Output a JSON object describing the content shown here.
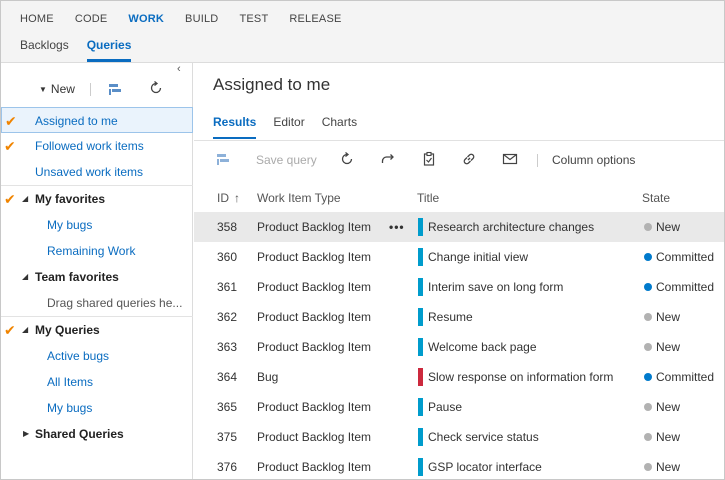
{
  "topnav": [
    "HOME",
    "CODE",
    "WORK",
    "BUILD",
    "TEST",
    "RELEASE"
  ],
  "topnav_active": "WORK",
  "subnav": [
    "Backlogs",
    "Queries"
  ],
  "subnav_active": "Queries",
  "left": {
    "collapse": "‹",
    "new_label": "New",
    "tree": [
      {
        "label": "Assigned to me",
        "type": "link",
        "check": true,
        "selected": true
      },
      {
        "label": "Followed work items",
        "type": "link",
        "check": true
      },
      {
        "label": "Unsaved work items",
        "type": "link"
      },
      {
        "label": "My favorites",
        "type": "head",
        "check": true,
        "expanded": true
      },
      {
        "label": "My bugs",
        "type": "link",
        "indent": true
      },
      {
        "label": "Remaining Work",
        "type": "link",
        "indent": true
      },
      {
        "label": "Team favorites",
        "type": "head",
        "expanded": true
      },
      {
        "label": "Drag shared queries he...",
        "type": "muted",
        "indent": true
      },
      {
        "label": "My Queries",
        "type": "head",
        "check": true,
        "expanded": true
      },
      {
        "label": "Active bugs",
        "type": "link",
        "indent": true
      },
      {
        "label": "All Items",
        "type": "link",
        "indent": true
      },
      {
        "label": "My bugs",
        "type": "link",
        "indent": true
      },
      {
        "label": "Shared Queries",
        "type": "head",
        "expanded": false
      }
    ]
  },
  "query": {
    "title": "Assigned to me",
    "tabs": [
      "Results",
      "Editor",
      "Charts"
    ],
    "active_tab": "Results",
    "toolbar": {
      "save_query": "Save query",
      "column_options": "Column options"
    },
    "columns": {
      "id": "ID",
      "type": "Work Item Type",
      "title": "Title",
      "state": "State"
    },
    "rows": [
      {
        "id": "358",
        "type": "Product Backlog Item",
        "title": "Research architecture changes",
        "state": "New",
        "selected": true
      },
      {
        "id": "360",
        "type": "Product Backlog Item",
        "title": "Change initial view",
        "state": "Committed"
      },
      {
        "id": "361",
        "type": "Product Backlog Item",
        "title": "Interim save on long form",
        "state": "Committed"
      },
      {
        "id": "362",
        "type": "Product Backlog Item",
        "title": "Resume",
        "state": "New"
      },
      {
        "id": "363",
        "type": "Product Backlog Item",
        "title": "Welcome back page",
        "state": "New"
      },
      {
        "id": "364",
        "type": "Bug",
        "title": "Slow response on information form",
        "state": "Committed"
      },
      {
        "id": "365",
        "type": "Product Backlog Item",
        "title": "Pause",
        "state": "New"
      },
      {
        "id": "375",
        "type": "Product Backlog Item",
        "title": "Check service status",
        "state": "New"
      },
      {
        "id": "376",
        "type": "Product Backlog Item",
        "title": "GSP locator interface",
        "state": "New"
      }
    ]
  },
  "colors": {
    "accent": "#0a6cc0",
    "pbi": "#009ccc",
    "bug": "#cc293d",
    "state_new": "#b2b2b2",
    "state_committed": "#007acc",
    "check": "#f08400"
  }
}
